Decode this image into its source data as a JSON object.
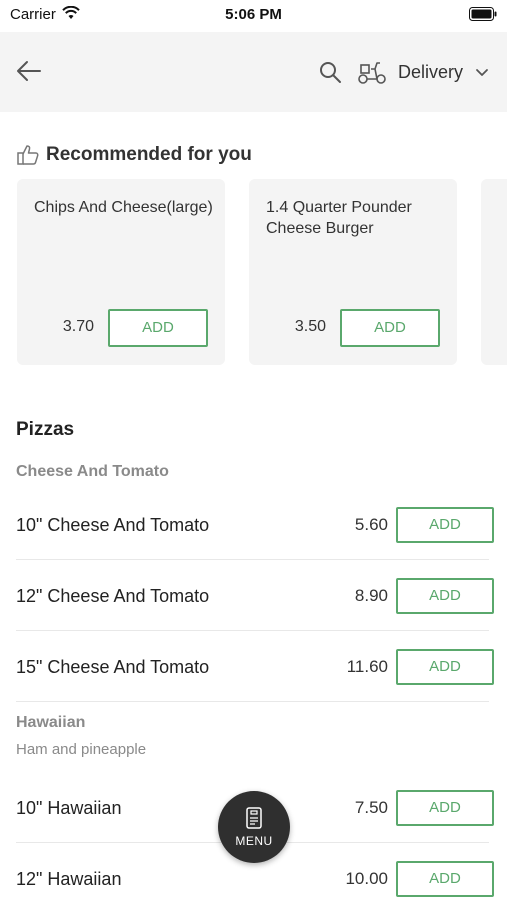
{
  "status_bar": {
    "carrier": "Carrier",
    "time": "5:06 PM"
  },
  "header": {
    "delivery_label": "Delivery"
  },
  "recommended": {
    "title": "Recommended for you",
    "items": [
      {
        "name": "Chips And Cheese(large)",
        "price": "3.70",
        "add_label": "ADD"
      },
      {
        "name": "1.4 Quarter Pounder Cheese Burger",
        "price": "3.50",
        "add_label": "ADD"
      }
    ]
  },
  "menu": {
    "section_title": "Pizzas",
    "groups": [
      {
        "title": "Cheese And Tomato",
        "items": [
          {
            "name": "10\" Cheese And Tomato",
            "price": "5.60",
            "add_label": "ADD"
          },
          {
            "name": "12\" Cheese And Tomato",
            "price": "8.90",
            "add_label": "ADD"
          },
          {
            "name": "15\" Cheese And Tomato",
            "price": "11.60",
            "add_label": "ADD"
          }
        ]
      },
      {
        "title": "Hawaiian",
        "description": "Ham and pineapple",
        "items": [
          {
            "name": "10\" Hawaiian",
            "price": "7.50",
            "add_label": "ADD"
          },
          {
            "name": "12\" Hawaiian",
            "price": "10.00",
            "add_label": "ADD"
          }
        ]
      }
    ]
  },
  "fab": {
    "label": "MENU",
    "icon": "menu-card-icon"
  },
  "colors": {
    "accent": "#5aa86c",
    "header_bg": "#f4f4f4",
    "card_bg": "#f4f4f4",
    "fab_bg": "#2f2f2f"
  }
}
